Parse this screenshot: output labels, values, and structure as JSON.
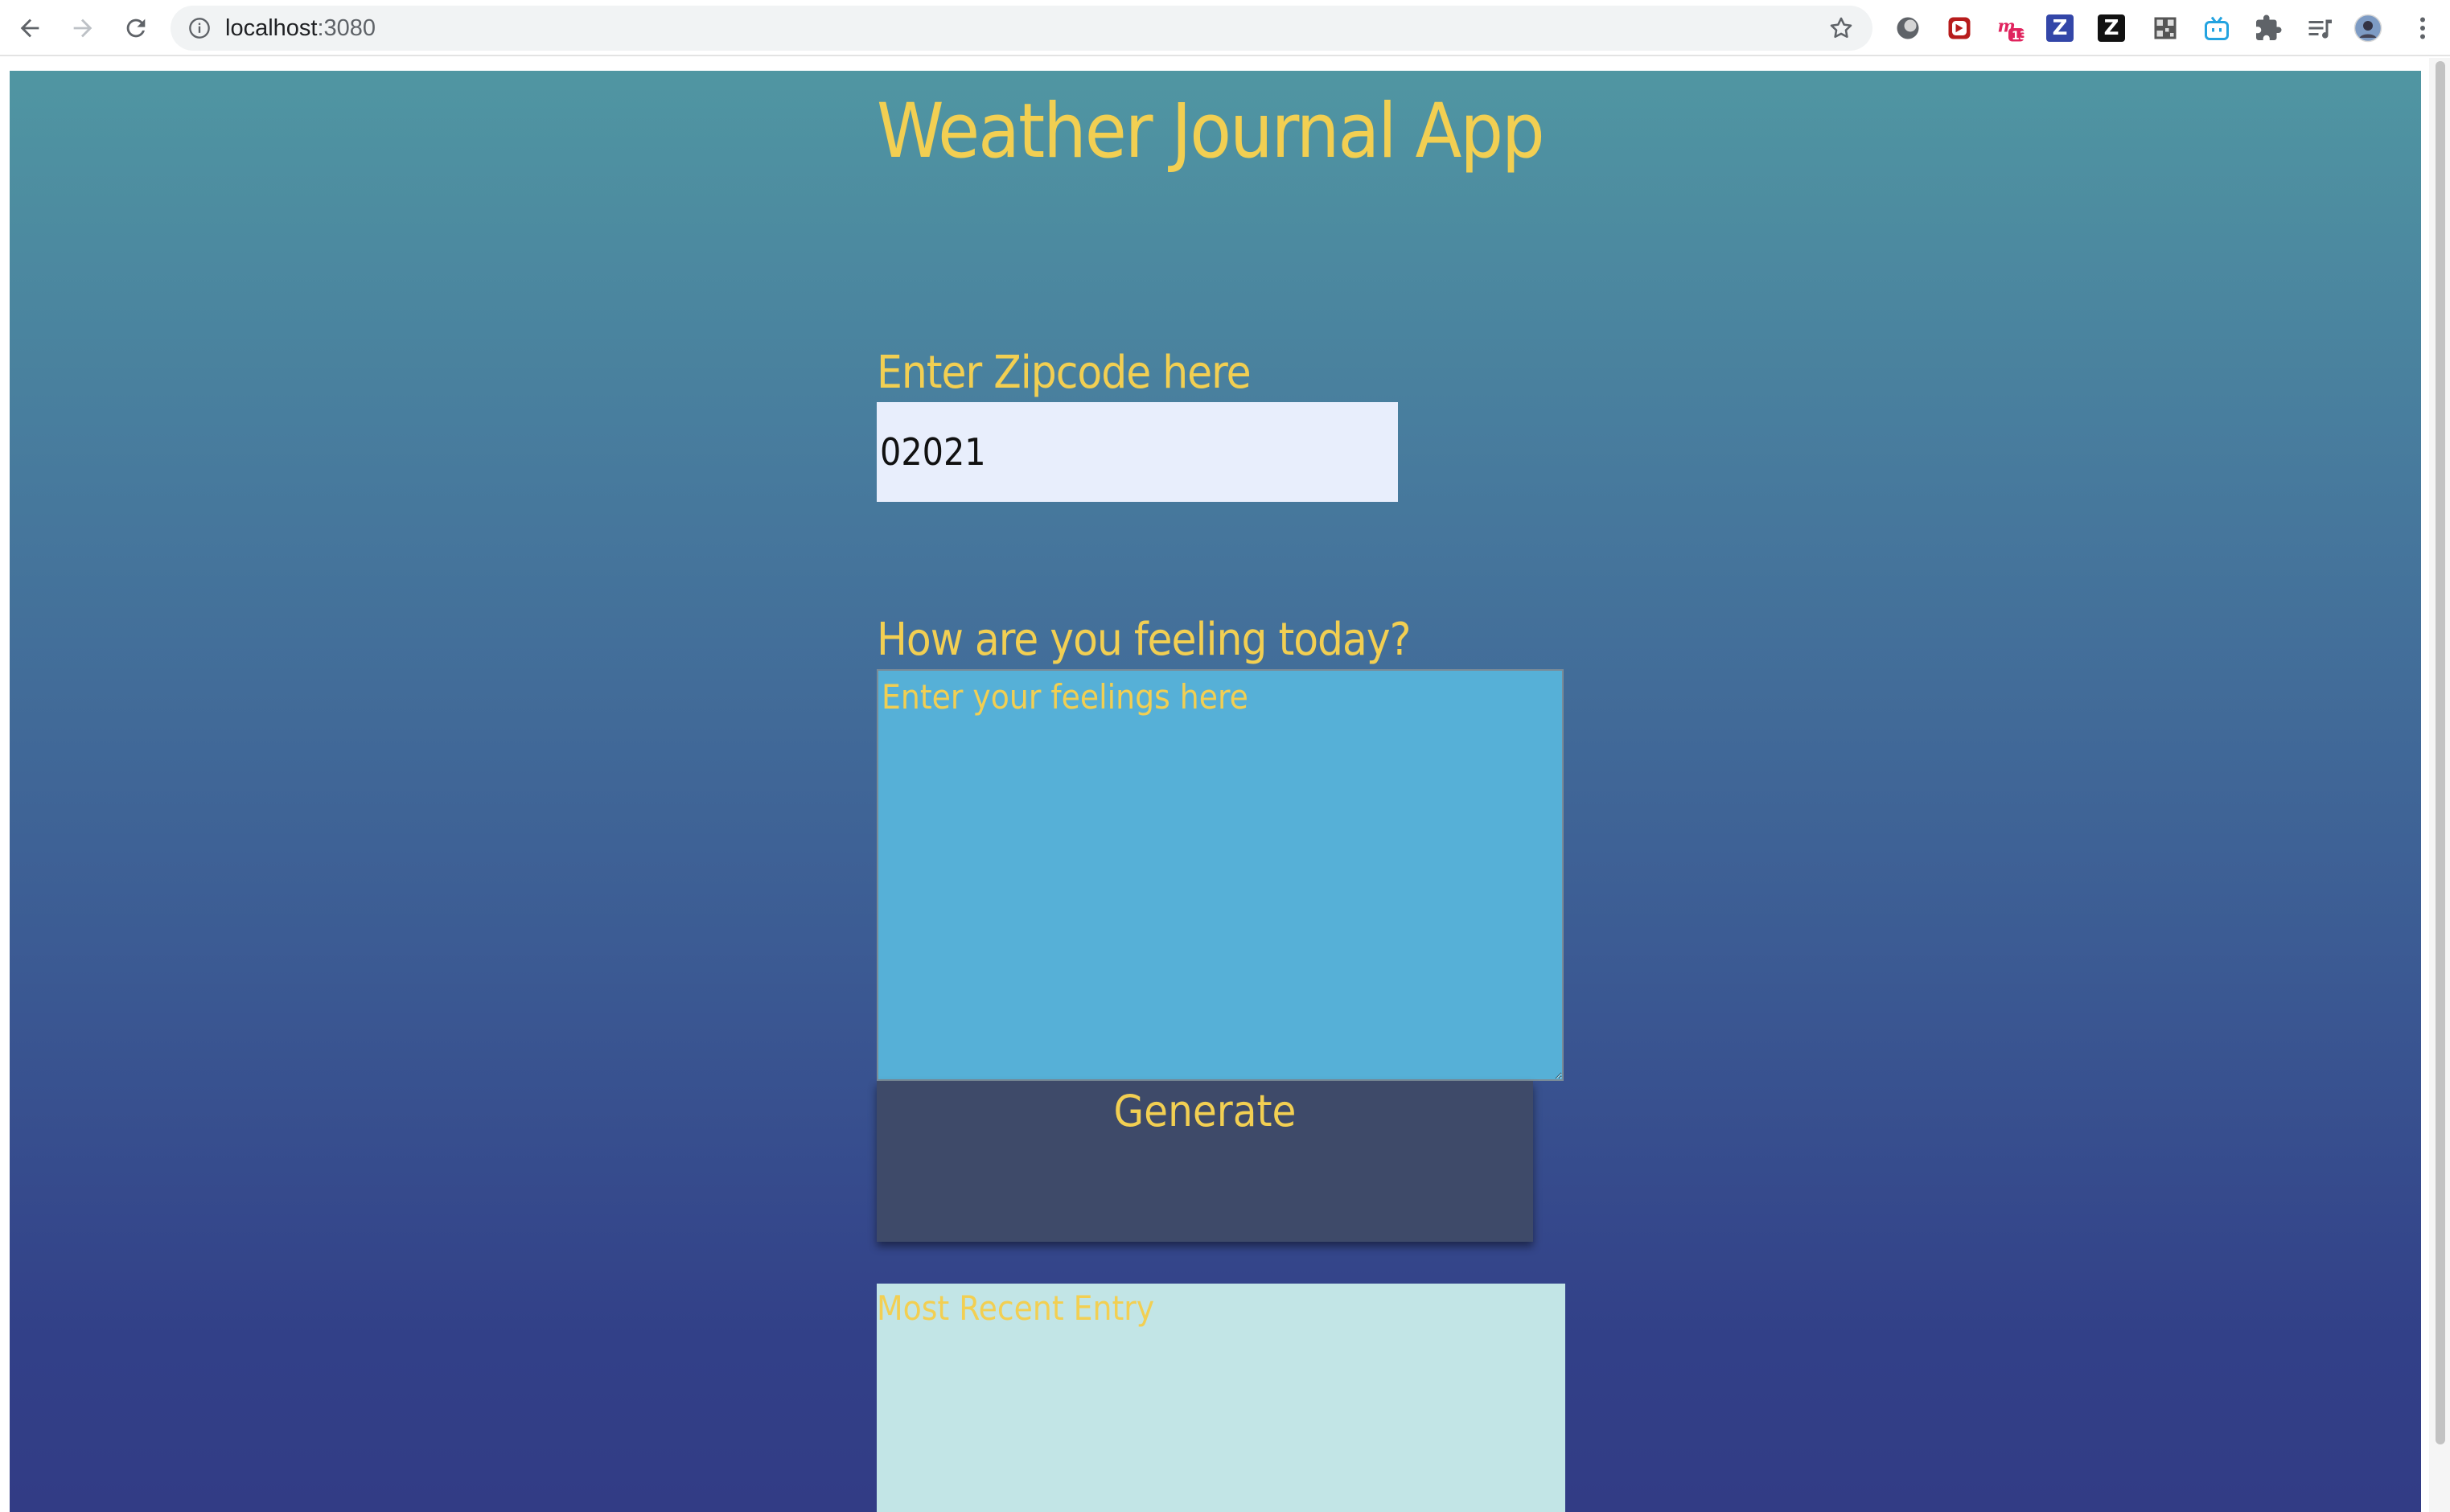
{
  "browser": {
    "url_host": "localhost",
    "url_port": ":3080",
    "extensions": [
      "circle-extension-icon",
      "video-extension-icon",
      "notes-extension-icon",
      "zotero-blue-icon",
      "zotero-black-icon",
      "qr-extension-icon",
      "bilibili-extension-icon",
      "puzzle-extensions-icon",
      "reading-list-icon",
      "profile-avatar"
    ],
    "notes_badge": "13",
    "z_letter": "Z"
  },
  "page": {
    "title": "Weather Journal App",
    "zip_label": "Enter Zipcode here",
    "zip_value": "02021",
    "feelings_label": "How are you feeling today?",
    "feelings_placeholder": "Enter your feelings here",
    "generate_label": "Generate",
    "entry_title": "Most Recent Entry"
  },
  "colors": {
    "accent_text": "#f2cf52",
    "gradient_top": "#5096a2",
    "gradient_bottom": "#323c85",
    "textarea_bg": "#56b0d7",
    "button_bg": "#3e4a69",
    "entry_bg": "#c2e5e6"
  }
}
